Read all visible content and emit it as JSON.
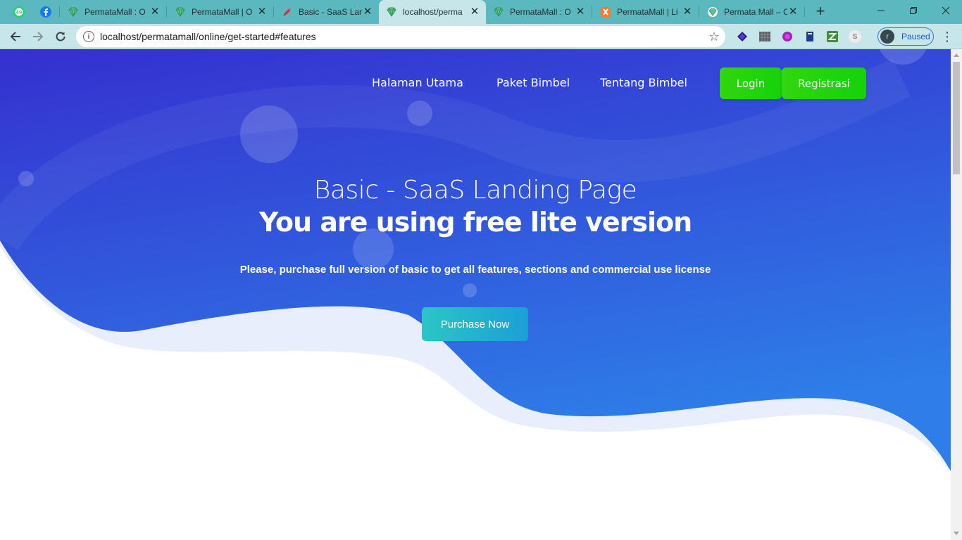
{
  "browser": {
    "tabs": [
      {
        "title": "PermataMall : O",
        "icon": "permatamall-icon",
        "active": false
      },
      {
        "title": "PermataMall | O",
        "icon": "permatamall-icon",
        "active": false
      },
      {
        "title": "Basic - SaaS Lan",
        "icon": "feather-icon",
        "active": false
      },
      {
        "title": "localhost/perma",
        "icon": "permatamall-icon",
        "active": true
      },
      {
        "title": "PermataMall : O",
        "icon": "permatamall-icon",
        "active": false
      },
      {
        "title": "PermataMall | Li",
        "icon": "xampp-icon",
        "active": false
      },
      {
        "title": "Permata Mall – C",
        "icon": "permatamall-icon",
        "active": false
      }
    ],
    "pinned": {
      "whatsapp_badge": "49"
    },
    "url": "localhost/permatamall/online/get-started#features",
    "profile": {
      "initial": "r",
      "status": "Paused"
    },
    "extensions": [
      "layers-icon",
      "grid-icon",
      "circle-icon",
      "book-icon",
      "zip-icon",
      "s-icon"
    ],
    "extension_s_label": "S",
    "colors": {
      "tabbar": "#5cb8bf",
      "toolbar": "#c6e6ea"
    }
  },
  "nav": {
    "home": "Halaman Utama",
    "packages": "Paket Bimbel",
    "about": "Tentang Bimbel",
    "login": "Login",
    "register": "Registrasi"
  },
  "hero": {
    "title": "Basic - SaaS Landing Page",
    "subtitle": "You are using free lite version",
    "description": "Please, purchase full version of basic to get all features, sections and commercial use license",
    "cta": "Purchase Now",
    "colors": {
      "gradient_top": "#3530cf",
      "gradient_bottom": "#2e7de8",
      "button_green": "#22d40c",
      "cta_start": "#2bc6c3",
      "cta_end": "#1b9fd7",
      "wave_shadow": "#e8eefb"
    }
  }
}
